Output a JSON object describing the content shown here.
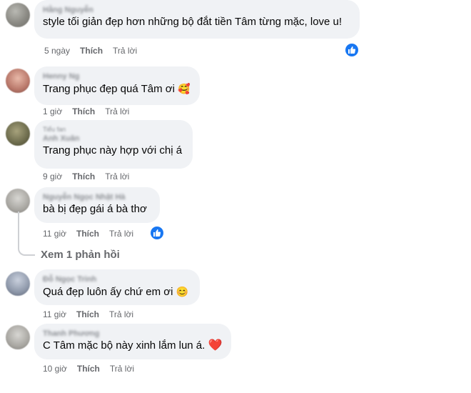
{
  "comments": [
    {
      "author": "Hằng Nguyễn",
      "sub": "",
      "text": "style tối giản đẹp hơn những bộ đắt tiền Tâm từng mặc, love u!",
      "emoji": "",
      "time": "5 ngày",
      "like": "Thích",
      "reply": "Trả lời",
      "reaction": "like"
    },
    {
      "author": "Henny Ng",
      "sub": "",
      "text": "Trang phục đẹp quá Tâm ơi",
      "emoji": "🥰",
      "time": "1 giờ",
      "like": "Thích",
      "reply": "Trả lời",
      "reaction": ""
    },
    {
      "author": "Anh Xuân",
      "sub": "Tiểu fan",
      "text": "Trang phục này hợp với chị á",
      "emoji": "",
      "time": "9 giờ",
      "like": "Thích",
      "reply": "Trả lời",
      "reaction": ""
    },
    {
      "author": "Nguyễn Ngọc Nhật Hà",
      "sub": "",
      "text": "bà bị đẹp gái á bà thơ",
      "emoji": "",
      "time": "11 giờ",
      "like": "Thích",
      "reply": "Trả lời",
      "reaction": "like"
    },
    {
      "author": "Đỗ Ngọc Trinh",
      "sub": "",
      "text": "Quá đẹp luôn ấy chứ em ơi",
      "emoji": "😊",
      "time": "11 giờ",
      "like": "Thích",
      "reply": "Trả lời",
      "reaction": ""
    },
    {
      "author": "Thanh Phương",
      "sub": "",
      "text": "C Tâm mặc bộ này xinh lắm lun á.",
      "emoji": "❤️",
      "time": "10 giờ",
      "like": "Thích",
      "reply": "Trả lời",
      "reaction": ""
    }
  ],
  "view_replies": "Xem 1 phản hồi",
  "icons": {
    "reaction": "thumbs-up-icon"
  },
  "colors": {
    "bubble": "#f0f2f5",
    "meta": "#65676b",
    "reaction": "#1877f2",
    "heart": "#e41e3f"
  }
}
